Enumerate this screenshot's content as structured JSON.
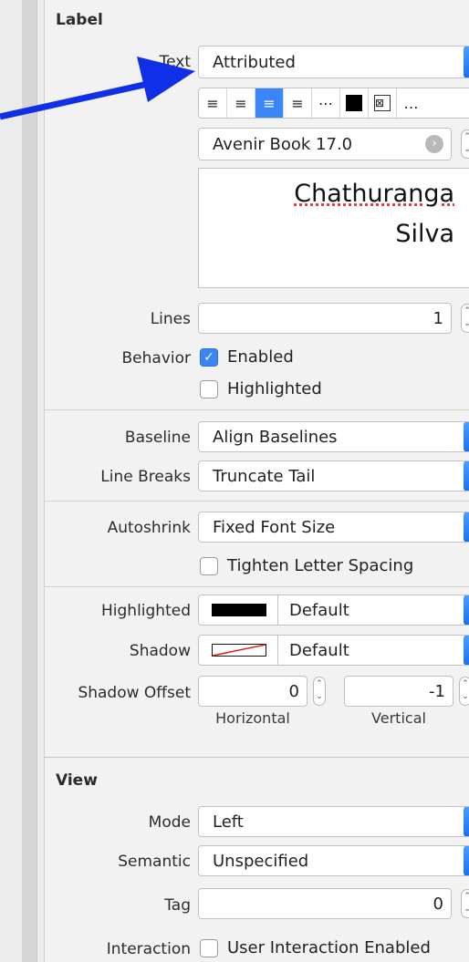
{
  "label_section": {
    "title": "Label",
    "text": {
      "label": "Text",
      "value": "Attributed"
    },
    "font": {
      "value": "Avenir Book 17.0"
    },
    "preview": {
      "line1": "Chathuranga",
      "line2": "Silva"
    },
    "lines": {
      "label": "Lines",
      "value": "1"
    },
    "behavior": {
      "label": "Behavior",
      "enabled": {
        "label": "Enabled",
        "checked": true
      },
      "highlighted": {
        "label": "Highlighted",
        "checked": false
      }
    },
    "baseline": {
      "label": "Baseline",
      "value": "Align Baselines"
    },
    "line_breaks": {
      "label": "Line Breaks",
      "value": "Truncate Tail"
    },
    "autoshrink": {
      "label": "Autoshrink",
      "value": "Fixed Font Size"
    },
    "tighten": {
      "label": "Tighten Letter Spacing",
      "checked": false
    },
    "highlighted_color": {
      "label": "Highlighted",
      "value": "Default",
      "swatch": "#000000"
    },
    "shadow": {
      "label": "Shadow",
      "value": "Default"
    },
    "shadow_offset": {
      "label": "Shadow Offset",
      "horizontal": {
        "value": "0",
        "label": "Horizontal"
      },
      "vertical": {
        "value": "-1",
        "label": "Vertical"
      }
    }
  },
  "view_section": {
    "title": "View",
    "mode": {
      "label": "Mode",
      "value": "Left"
    },
    "semantic": {
      "label": "Semantic",
      "value": "Unspecified"
    },
    "tag": {
      "label": "Tag",
      "value": "0"
    },
    "interaction": {
      "label": "Interaction",
      "user_interaction": {
        "label": "User Interaction Enabled",
        "checked": false
      }
    }
  },
  "colors": {
    "accent": "#3a86f7",
    "arrow": "#1030e8",
    "panel": "#f2f2f2"
  }
}
